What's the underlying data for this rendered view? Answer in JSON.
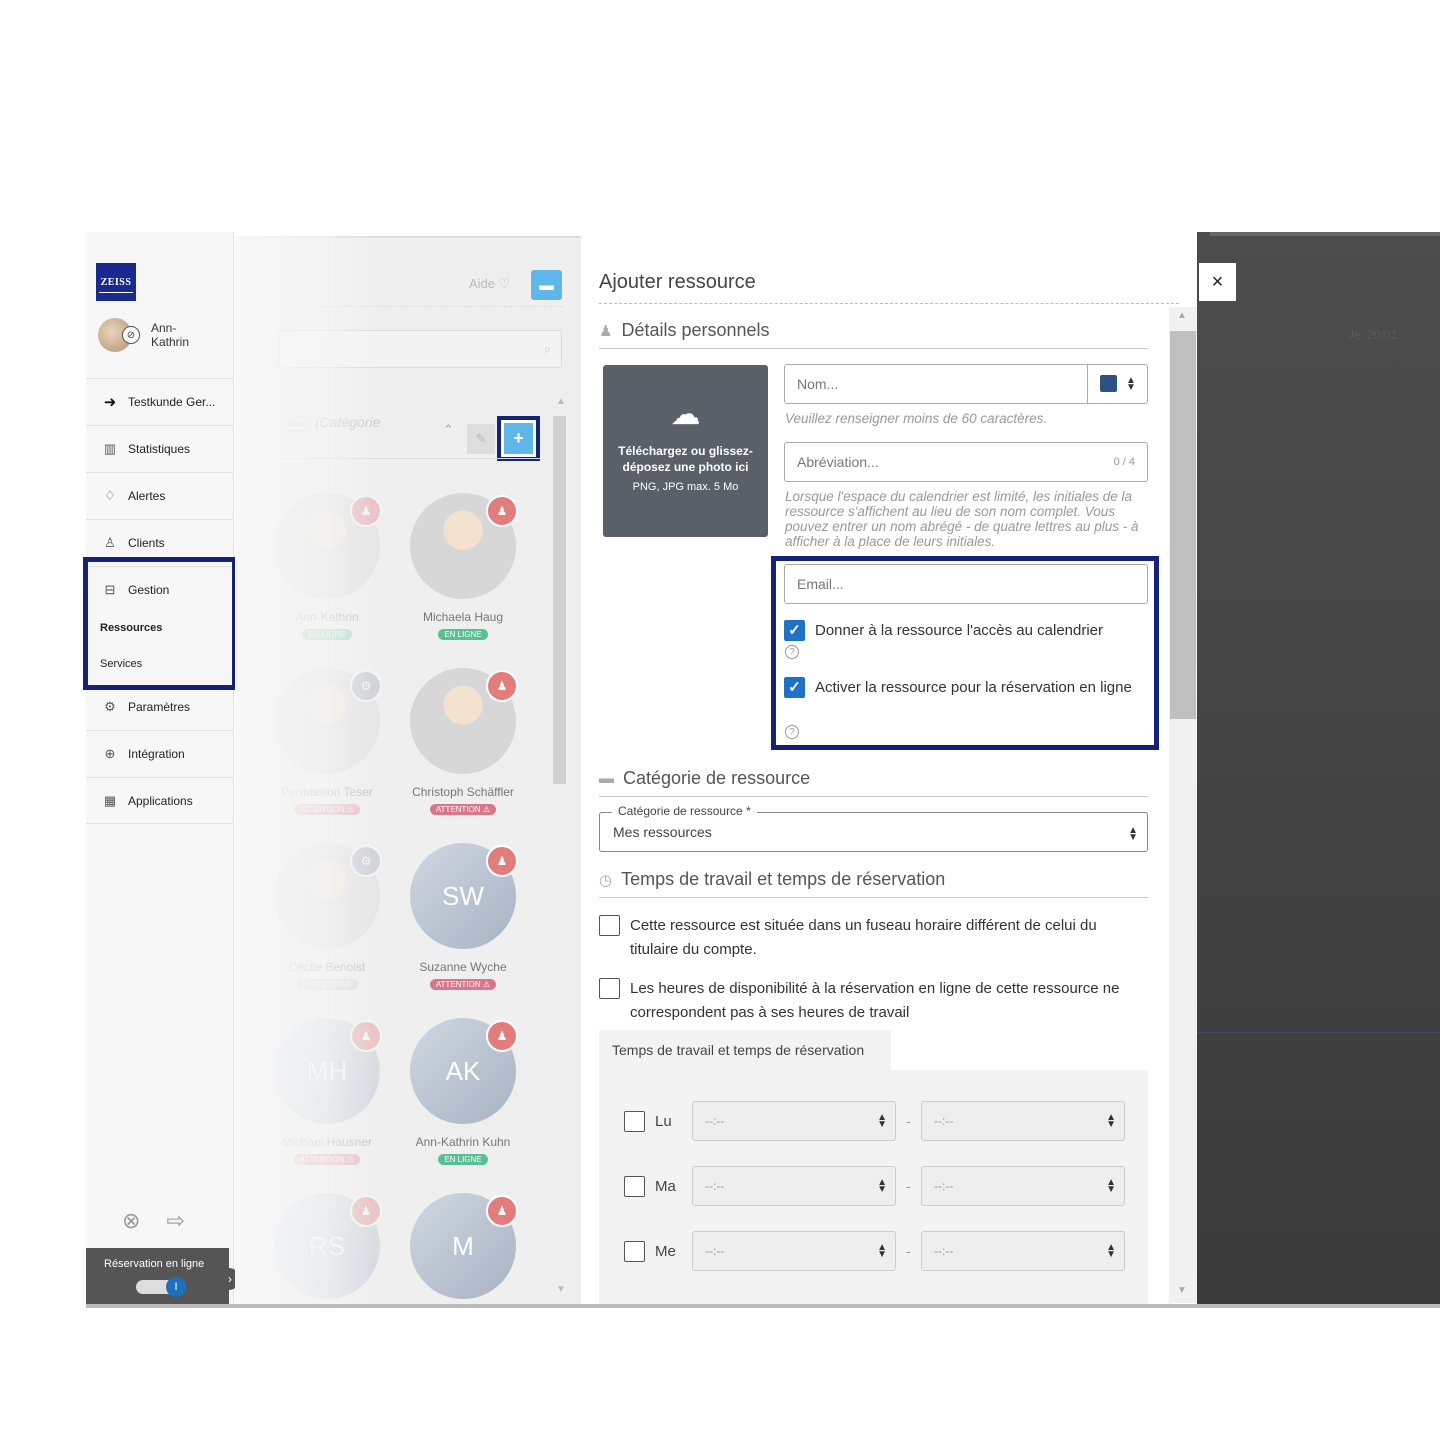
{
  "sidebar": {
    "logo": "ZEISS",
    "user_name": "Ann-Kathrin",
    "items": [
      {
        "label": "Testkunde Ger...",
        "icon": "back-arrow-icon"
      },
      {
        "label": "Statistiques",
        "icon": "bar-chart-icon"
      },
      {
        "label": "Alertes",
        "icon": "bell-icon"
      },
      {
        "label": "Clients",
        "icon": "user-icon"
      },
      {
        "label": "Gestion",
        "icon": "briefcase-icon"
      },
      {
        "label": "Paramètres",
        "icon": "gears-icon"
      },
      {
        "label": "Intégration",
        "icon": "integration-icon"
      },
      {
        "label": "Applications",
        "icon": "grid-icon"
      }
    ],
    "subitems": [
      {
        "label": "Ressources",
        "active": true
      },
      {
        "label": "Services",
        "active": false
      }
    ],
    "online_booking_label": "Réservation en ligne",
    "online_booking_enabled": true
  },
  "resource_list": {
    "help_label": "Aide",
    "category_label": "(Catégorie",
    "category_pill": "Tout",
    "resources": [
      {
        "name": "Ann-Kathrin",
        "status": "EN LIGNE",
        "badge": "red",
        "initials": ""
      },
      {
        "name": "Michaela Haug",
        "status": "EN LIGNE",
        "badge": "red",
        "initials": ""
      },
      {
        "name": "Permission Teser",
        "status": "ATTENTION",
        "badge": "gray",
        "initials": ""
      },
      {
        "name": "Christoph Schäffler",
        "status": "ATTENTION",
        "badge": "red",
        "initials": ""
      },
      {
        "name": "Cécile Benoist",
        "status": "HORS LIGNE",
        "badge": "gray",
        "initials": ""
      },
      {
        "name": "Suzanne Wyche",
        "status": "ATTENTION",
        "badge": "red",
        "initials": "SW"
      },
      {
        "name": "Michael Hausner",
        "status": "ATTENTION",
        "badge": "red",
        "initials": "MH"
      },
      {
        "name": "Ann-Kathrin Kuhn",
        "status": "EN LIGNE",
        "badge": "red",
        "initials": "AK"
      },
      {
        "name": "",
        "status": "",
        "badge": "red",
        "initials": "RS"
      },
      {
        "name": "",
        "status": "",
        "badge": "red",
        "initials": "M"
      }
    ]
  },
  "form": {
    "title": "Ajouter ressource",
    "personal_section": "Détails personnels",
    "upload_title": "Téléchargez ou glissez-déposez une photo ici",
    "upload_subtitle": "PNG, JPG max. 5 Mo",
    "name_placeholder": "Nom...",
    "name_hint": "Veuillez renseigner moins de 60 caractères.",
    "abbr_placeholder": "Abréviation...",
    "abbr_counter": "0 / 4",
    "abbr_hint": "Lorsque l'espace du calendrier est limité, les initiales de la ressource s'affichent au lieu de son nom complet. Vous pouvez entrer un nom abrégé - de quatre lettres au plus - à afficher à la place de leurs initiales.",
    "email_placeholder": "Email...",
    "calendar_access_label": "Donner à la ressource l'accès au calendrier",
    "calendar_access_checked": true,
    "online_booking_label": "Activer la ressource pour la réservation en ligne",
    "online_booking_checked": true,
    "category_section": "Catégorie de ressource",
    "category_legend": "Catégorie de ressource *",
    "category_value": "Mes ressources",
    "time_section": "Temps de travail et temps de réservation",
    "timezone_label": "Cette ressource est située dans un fuseau horaire différent de celui du titulaire du compte.",
    "hours_label": "Les heures de disponibilité à la réservation en ligne de cette ressource ne correspondent pas à ses heures de travail",
    "tab_label": "Temps de travail et temps de réservation",
    "days": [
      {
        "label": "Lu",
        "from": "--:--",
        "to": "--:--"
      },
      {
        "label": "Ma",
        "from": "--:--",
        "to": "--:--"
      },
      {
        "label": "Me",
        "from": "--:--",
        "to": "--:--"
      }
    ],
    "time_separator": "-"
  },
  "overlay": {
    "close_label": "×",
    "date_label": "Je. 20/01"
  },
  "colors": {
    "highlight": "#14237a",
    "accent": "#5fb6e9",
    "checkbox": "#1f72c8",
    "resource_color": "#2c5283"
  }
}
